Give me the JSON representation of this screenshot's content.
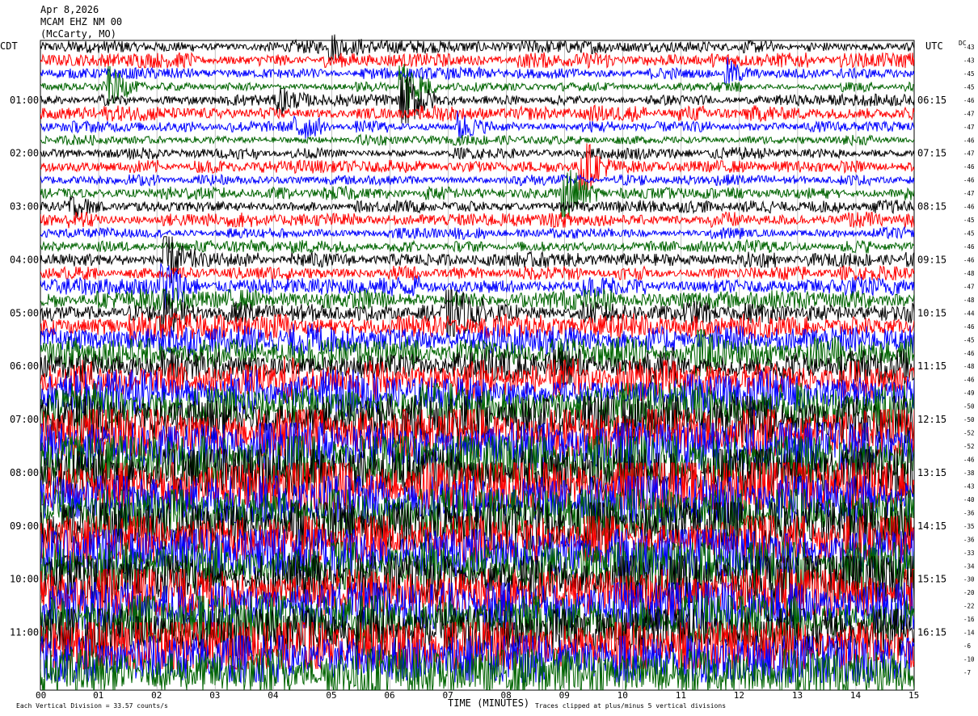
{
  "header": {
    "date": "Apr 8,2026",
    "station": "MCAM EHZ NM 00",
    "location": "(McCarty, MO)"
  },
  "labels": {
    "left_tz": "CDT",
    "right_tz": "UTC",
    "dc": "DC",
    "xlabel": "TIME (MINUTES)",
    "footer_left": "Each Vertical Division = 33.57 counts/s",
    "footer_right": "Traces clipped at plus/minus 5 vertical divisions"
  },
  "chart_data": {
    "type": "line",
    "title": "MCAM EHZ NM 00 (McCarty, MO) Apr 8,2026",
    "xlabel": "TIME (MINUTES)",
    "xlim": [
      0,
      15
    ],
    "x_ticks": [
      "00",
      "01",
      "02",
      "03",
      "04",
      "05",
      "06",
      "07",
      "08",
      "09",
      "10",
      "11",
      "12",
      "13",
      "14",
      "15"
    ],
    "trace_count": 48,
    "trace_colors": [
      "#000000",
      "#ff0000",
      "#0000ff",
      "#006400"
    ],
    "cdt_hour_labels": [
      "01:00",
      "02:00",
      "03:00",
      "04:00",
      "05:00",
      "06:00",
      "07:00",
      "08:00",
      "09:00",
      "10:00",
      "11:00"
    ],
    "utc_hour_labels": [
      "06:15",
      "07:15",
      "08:15",
      "09:15",
      "10:15",
      "11:15",
      "12:15",
      "13:15",
      "14:15",
      "15:15",
      "16:15"
    ],
    "dc_offsets": [
      -43,
      -43,
      -45,
      -45,
      -46,
      -47,
      -47,
      -46,
      -47,
      -46,
      -46,
      -47,
      -46,
      -45,
      -45,
      -46,
      -46,
      -48,
      -47,
      -48,
      -44,
      -46,
      -45,
      -46,
      -48,
      -46,
      -49,
      -50,
      -50,
      -52,
      -52,
      -46,
      -38,
      -43,
      -40,
      -36,
      -35,
      -36,
      -33,
      -34,
      -30,
      -20,
      -22,
      -16,
      -14,
      -6,
      -10,
      -7
    ],
    "trace_amplitudes": [
      1.0,
      1.2,
      0.9,
      0.8,
      0.9,
      1.2,
      0.9,
      0.8,
      0.9,
      1.0,
      0.9,
      1.1,
      1.0,
      1.3,
      0.9,
      1.0,
      1.2,
      1.1,
      1.6,
      1.7,
      1.8,
      2.0,
      2.4,
      2.6,
      2.8,
      3.2,
      3.8,
      4.2,
      4.6,
      5.0,
      5.0,
      5.0,
      5.0,
      5.0,
      5.0,
      5.0,
      5.0,
      5.0,
      5.0,
      5.0,
      5.0,
      5.0,
      5.0,
      5.0,
      5.0,
      5.0,
      5.0,
      5.0
    ],
    "events": [
      {
        "trace": 0,
        "minute": 5.0,
        "amp": 3.0
      },
      {
        "trace": 3,
        "minute": 1.2,
        "amp": 3.5
      },
      {
        "trace": 3,
        "minute": 6.2,
        "amp": 9.0
      },
      {
        "trace": 4,
        "minute": 6.2,
        "amp": 9.0
      },
      {
        "trace": 4,
        "minute": 4.1,
        "amp": 2.5
      },
      {
        "trace": 6,
        "minute": 4.4,
        "amp": 3.0
      },
      {
        "trace": 6,
        "minute": 7.2,
        "amp": 3.0
      },
      {
        "trace": 2,
        "minute": 11.8,
        "amp": 3.0
      },
      {
        "trace": 9,
        "minute": 9.3,
        "amp": 7.0
      },
      {
        "trace": 11,
        "minute": 9.0,
        "amp": 7.0
      },
      {
        "trace": 12,
        "minute": 0.5,
        "amp": 2.0
      },
      {
        "trace": 16,
        "minute": 2.1,
        "amp": 8.0
      },
      {
        "trace": 18,
        "minute": 2.1,
        "amp": 7.0
      },
      {
        "trace": 20,
        "minute": 7.0,
        "amp": 6.0
      },
      {
        "trace": 20,
        "minute": 2.1,
        "amp": 6.0
      },
      {
        "trace": 23,
        "minute": 11.3,
        "amp": 5.0
      },
      {
        "trace": 27,
        "minute": 10.5,
        "amp": 4.0
      },
      {
        "trace": 25,
        "minute": 4.2,
        "amp": 5.0
      }
    ]
  }
}
